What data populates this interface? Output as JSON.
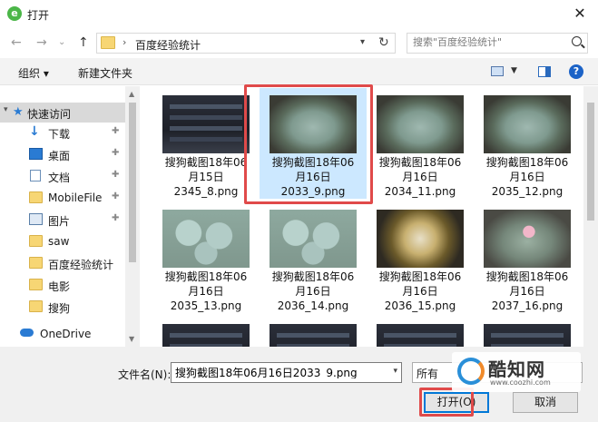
{
  "window": {
    "title": "打开",
    "app_icon_glyph": "e",
    "close_glyph": "✕"
  },
  "nav": {
    "back_glyph": "←",
    "forward_glyph": "→",
    "history_glyph": "⌄",
    "up_glyph": "↑",
    "path_sep": "›",
    "path": "百度经验统计",
    "search_placeholder": "搜索\"百度经验统计\""
  },
  "toolbar": {
    "organize": "组织 ▾",
    "new_folder": "新建文件夹",
    "help": "?"
  },
  "sidebar": {
    "items": [
      {
        "label": "快速访问",
        "icon": "star-icon"
      },
      {
        "label": "下载",
        "icon": "download-icon"
      },
      {
        "label": "桌面",
        "icon": "desktop-icon"
      },
      {
        "label": "文档",
        "icon": "document-icon"
      },
      {
        "label": "MobileFile",
        "icon": "folder-icon"
      },
      {
        "label": "图片",
        "icon": "pictures-icon"
      },
      {
        "label": "saw",
        "icon": "folder-icon"
      },
      {
        "label": "百度经验统计",
        "icon": "folder-icon"
      },
      {
        "label": "电影",
        "icon": "folder-icon"
      },
      {
        "label": "搜狗",
        "icon": "folder-icon"
      },
      {
        "label": "OneDrive",
        "icon": "cloud-icon"
      }
    ],
    "pin_glyph": "📌"
  },
  "files": [
    {
      "name": "搜狗截图18年06月15日2345_8.png",
      "l1": "搜狗截图18年06",
      "l2": "月15日",
      "l3": "2345_8.png",
      "thumb": "dark",
      "selected": false
    },
    {
      "name": "搜狗截图18年06月16日2033_9.png",
      "l1": "搜狗截图18年06",
      "l2": "月16日",
      "l3": "2033_9.png",
      "thumb": "pot",
      "selected": true
    },
    {
      "name": "搜狗截图18年06月16日2034_11.png",
      "l1": "搜狗截图18年06",
      "l2": "月16日",
      "l3": "2034_11.png",
      "thumb": "pot",
      "selected": false
    },
    {
      "name": "搜狗截图18年06月16日2035_12.png",
      "l1": "搜狗截图18年06",
      "l2": "月16日",
      "l3": "2035_12.png",
      "thumb": "pot",
      "selected": false
    },
    {
      "name": "搜狗截图18年06月16日2035_13.png",
      "l1": "搜狗截图18年06",
      "l2": "月16日",
      "l3": "2035_13.png",
      "thumb": "pale",
      "selected": false
    },
    {
      "name": "搜狗截图18年06月16日2036_14.png",
      "l1": "搜狗截图18年06",
      "l2": "月16日",
      "l3": "2036_14.png",
      "thumb": "pale",
      "selected": false
    },
    {
      "name": "搜狗截图18年06月16日2036_15.png",
      "l1": "搜狗截图18年06",
      "l2": "月16日",
      "l3": "2036_15.png",
      "thumb": "spiky",
      "selected": false
    },
    {
      "name": "搜狗截图18年06月16日2037_16.png",
      "l1": "搜狗截图18年06",
      "l2": "月16日",
      "l3": "2037_16.png",
      "thumb": "pink",
      "selected": false
    }
  ],
  "footer": {
    "filename_label": "文件名(N):",
    "filename_value": "搜狗截图18年06月16日2033_9.png",
    "type_value": "所有",
    "open_label": "打开(O)",
    "cancel_label": "取消"
  },
  "watermark": {
    "title": "酷知网",
    "url": "www.coozhi.com"
  },
  "colors": {
    "accent": "#0078d7",
    "selection": "#cce8ff",
    "highlight": "#e04a4a"
  }
}
